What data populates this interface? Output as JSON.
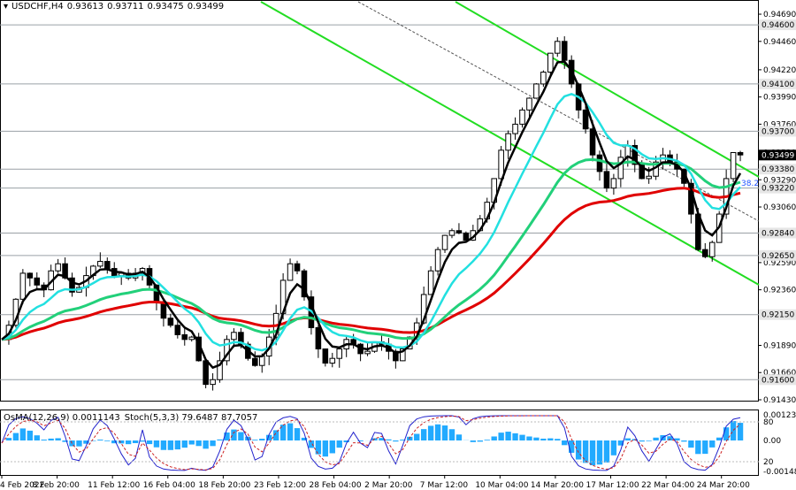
{
  "header": {
    "symbol": "USDCHF,H4",
    "open": "0.93613",
    "high": "0.93711",
    "low": "0.93475",
    "close": "0.93499"
  },
  "indicator": {
    "osma": "OsMA(12,26,9) 0.0011143",
    "stoch": "Stoch(5,3,3) 79.6487 87.7057"
  },
  "colors": {
    "ema_fast": "#000000",
    "ema_mid": "#22e0e0",
    "ema_slow1": "#22d07a",
    "ema_slow2": "#e00000",
    "channel": "#22dd22",
    "candles": "#000000",
    "osma_bars": "#22aaff",
    "stoch_main": "#2222cc",
    "stoch_signal": "#cc2222"
  },
  "chart_data": {
    "type": "candlestick",
    "price_range": [
      0.9143,
      0.9478
    ],
    "price_axis_ticks": [
      "0.94690",
      "0.94460",
      "0.94220",
      "0.93990",
      "0.93760",
      "0.93520",
      "0.93290",
      "0.93060",
      "0.92830",
      "0.92590",
      "0.92360",
      "0.92130",
      "0.91890",
      "0.91660",
      "0.91430"
    ],
    "level_tags": [
      "0.94600",
      "0.94100",
      "0.93700",
      "0.93499",
      "0.93380",
      "0.93220",
      "0.92840",
      "0.92650",
      "0.92150",
      "0.91600"
    ],
    "current_price": "0.93499",
    "fib_label": "38.2",
    "osc_axis_ticks": [
      "0.001238",
      "0.00",
      "-0.001485"
    ],
    "stoch_axis_ticks": [
      "80",
      "20"
    ],
    "time_labels": [
      "4 Feb 2022",
      "8 Feb 20:00",
      "11 Feb 12:00",
      "16 Feb 04:00",
      "18 Feb 20:00",
      "23 Feb 12:00",
      "28 Feb 04:00",
      "2 Mar 20:00",
      "7 Mar 12:00",
      "10 Mar 04:00",
      "14 Mar 20:00",
      "17 Mar 12:00",
      "22 Mar 04:00",
      "24 Mar 20:00"
    ],
    "close_path": [
      0.9194,
      0.9206,
      0.9228,
      0.925,
      0.9246,
      0.924,
      0.9236,
      0.9252,
      0.9258,
      0.9246,
      0.9234,
      0.9238,
      0.9248,
      0.9256,
      0.926,
      0.9254,
      0.9248,
      0.925,
      0.9246,
      0.925,
      0.9254,
      0.924,
      0.9226,
      0.9212,
      0.9206,
      0.9198,
      0.9194,
      0.9196,
      0.9176,
      0.9156,
      0.916,
      0.9176,
      0.9194,
      0.92,
      0.919,
      0.9178,
      0.9172,
      0.918,
      0.9196,
      0.9216,
      0.9244,
      0.9258,
      0.9252,
      0.923,
      0.9204,
      0.9186,
      0.9174,
      0.9178,
      0.9186,
      0.9194,
      0.919,
      0.9182,
      0.9184,
      0.9192,
      0.919,
      0.9184,
      0.9176,
      0.9186,
      0.9196,
      0.9208,
      0.9232,
      0.9252,
      0.927,
      0.9282,
      0.9286,
      0.9284,
      0.9278,
      0.9286,
      0.9296,
      0.931,
      0.933,
      0.9354,
      0.9368,
      0.9376,
      0.9388,
      0.9398,
      0.941,
      0.942,
      0.9436,
      0.9446,
      0.943,
      0.941,
      0.9388,
      0.9372,
      0.935,
      0.9336,
      0.9322,
      0.933,
      0.9348,
      0.9358,
      0.9342,
      0.933,
      0.9332,
      0.9344,
      0.935,
      0.9344,
      0.9338,
      0.9326,
      0.93,
      0.927,
      0.9264,
      0.9276,
      0.93,
      0.933,
      0.9352,
      0.935
    ]
  }
}
